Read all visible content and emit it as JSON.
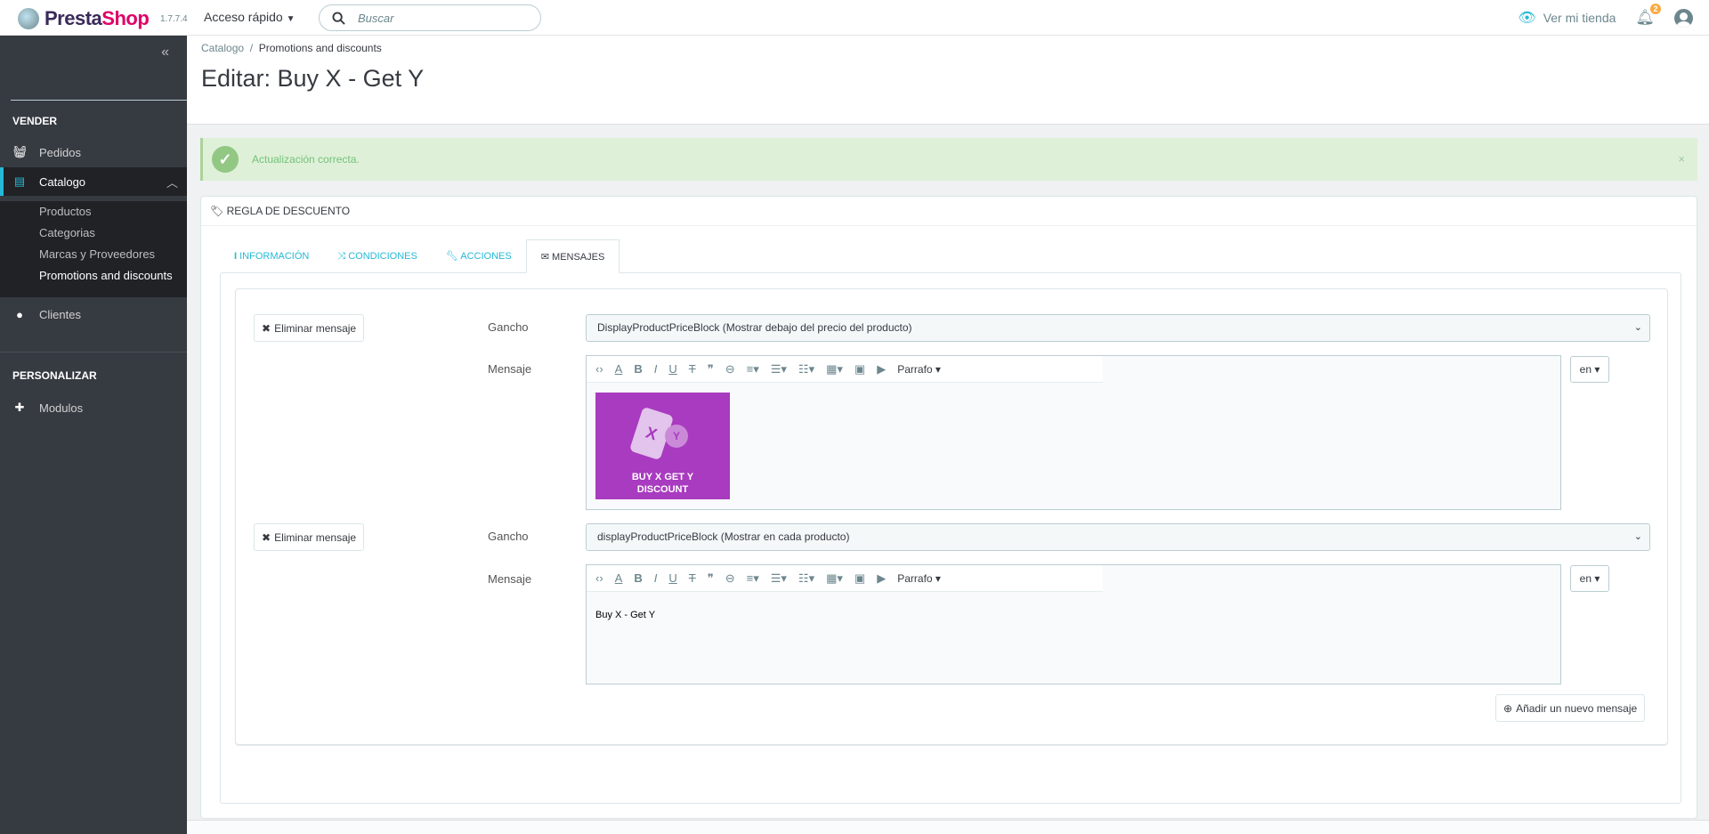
{
  "topbar": {
    "brand": "PrestaShop",
    "version": "1.7.7.4",
    "quick_access": "Acceso rápido",
    "search_placeholder": "Buscar",
    "view_store": "Ver mi tienda",
    "notification_count": "2"
  },
  "sidebar": {
    "sections": [
      {
        "title": "VENDER",
        "items": [
          {
            "label": "Pedidos",
            "icon": "basket-icon"
          },
          {
            "label": "Catalogo",
            "icon": "store-icon",
            "active": true,
            "children": [
              "Productos",
              "Categorias",
              "Marcas y Proveedores",
              "Promotions and discounts"
            ]
          },
          {
            "label": "Clientes",
            "icon": "user-circle-icon"
          }
        ]
      },
      {
        "title": "PERSONALIZAR",
        "items": [
          {
            "label": "Modulos",
            "icon": "puzzle-icon"
          }
        ]
      }
    ]
  },
  "header": {
    "breadcrumb": [
      "Catalogo",
      "Promotions and discounts"
    ],
    "title": "Editar: Buy X - Get Y"
  },
  "alert": {
    "text": "Actualización correcta.",
    "type": "success"
  },
  "card": {
    "title": "REGLA DE DESCUENTO",
    "tabs": [
      {
        "label": "INFORMACIÓN"
      },
      {
        "label": "CONDICIONES"
      },
      {
        "label": "ACCIONES"
      },
      {
        "label": "MENSAJES",
        "active": true
      }
    ],
    "messages": [
      {
        "delete_label": "Eliminar mensaje",
        "hook_label": "Gancho",
        "hook_value": "DisplayProductPriceBlock (Mostrar debajo del precio del producto)",
        "message_label": "Mensaje",
        "paragraph": "Parrafo",
        "lang": "en",
        "image_text_1": "BUY X GET Y",
        "image_text_2": "DISCOUNT"
      },
      {
        "delete_label": "Eliminar mensaje",
        "hook_label": "Gancho",
        "hook_value": "displayProductPriceBlock (Mostrar en cada producto)",
        "message_label": "Mensaje",
        "paragraph": "Parrafo",
        "lang": "en",
        "content": "Buy X - Get Y"
      }
    ],
    "add_label": "Añadir un nuevo mensaje"
  },
  "colors": {
    "accent": "#25b9d7",
    "sidebar": "#363a41",
    "success_bg": "#dff0d8",
    "brand_pink": "#df0067"
  }
}
